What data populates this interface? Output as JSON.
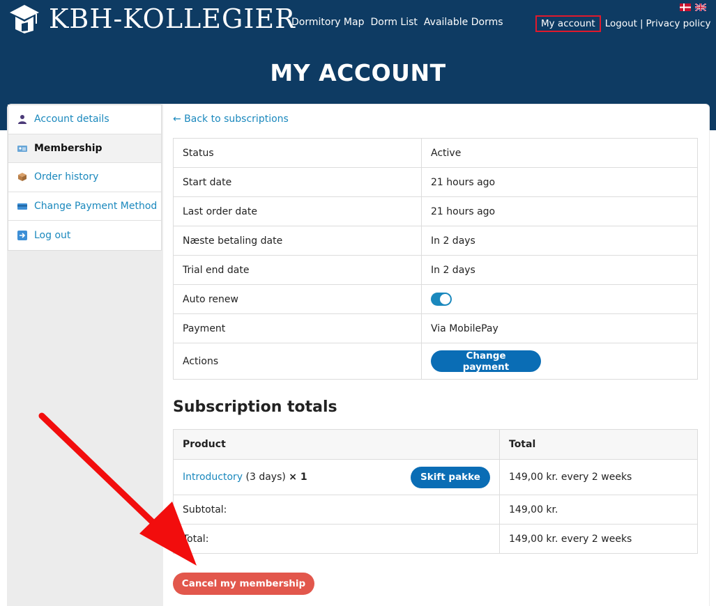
{
  "brand": {
    "name": "KBH-KOLLEGIER"
  },
  "nav": {
    "items": [
      "Dormitory Map",
      "Dorm List",
      "Available Dorms"
    ]
  },
  "top_links": {
    "my_account": "My account",
    "logout": "Logout",
    "separator": "|",
    "privacy": "Privacy policy"
  },
  "page": {
    "title": "MY ACCOUNT"
  },
  "sidebar": {
    "items": [
      {
        "label": "Account details",
        "icon": "user-icon"
      },
      {
        "label": "Membership",
        "icon": "id-card-icon"
      },
      {
        "label": "Order history",
        "icon": "box-icon"
      },
      {
        "label": "Change Payment Method",
        "icon": "credit-card-icon"
      },
      {
        "label": "Log out",
        "icon": "logout-icon"
      }
    ]
  },
  "back_link": "← Back to subscriptions",
  "details": {
    "rows": [
      {
        "label": "Status",
        "value": "Active"
      },
      {
        "label": "Start date",
        "value": "21 hours ago"
      },
      {
        "label": "Last order date",
        "value": "21 hours ago"
      },
      {
        "label": "Næste betaling date",
        "value": "In 2 days"
      },
      {
        "label": "Trial end date",
        "value": "In 2 days"
      },
      {
        "label": "Auto renew",
        "value": ""
      },
      {
        "label": "Payment",
        "value": "Via MobilePay"
      },
      {
        "label": "Actions",
        "value": ""
      }
    ],
    "auto_renew_on": true,
    "change_payment_label": "Change payment"
  },
  "totals": {
    "title": "Subscription totals",
    "headers": {
      "product": "Product",
      "total": "Total"
    },
    "product": {
      "name": "Introductory",
      "extra": "(3 days)",
      "qty": "× 1",
      "button": "Skift pakke",
      "total": "149,00 kr. every 2 weeks"
    },
    "subtotal": {
      "label": "Subtotal:",
      "value": "149,00 kr."
    },
    "total": {
      "label": "Total:",
      "value": "149,00 kr. every 2 weeks"
    }
  },
  "cancel_label": "Cancel my membership",
  "colors": {
    "header": "#0e3b63",
    "link": "#1a88bd",
    "button_blue": "#0a6db5",
    "cancel": "#e2574c",
    "highlight": "#e0192c"
  }
}
